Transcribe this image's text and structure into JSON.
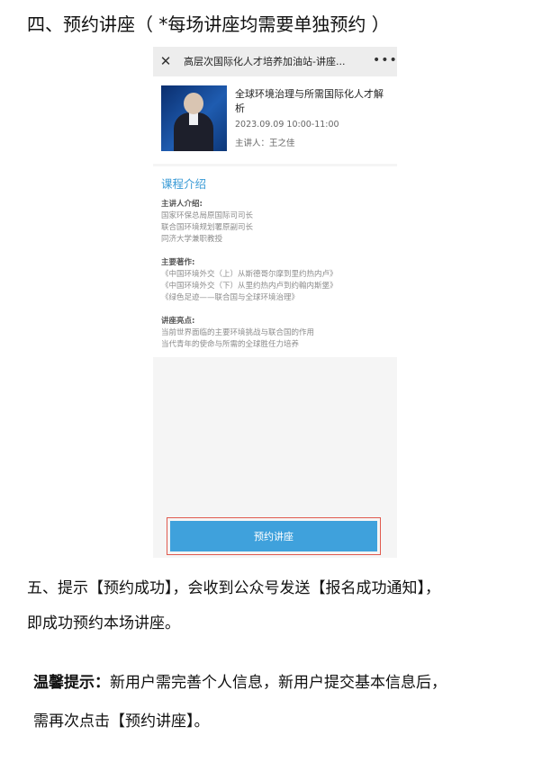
{
  "section4": {
    "title": "四、预约讲座（ *每场讲座均需要单独预约 ）"
  },
  "phone": {
    "topbar": {
      "close_icon": "close-icon",
      "title": "高层次国际化人才培养加油站-讲座...",
      "more_icon": "more-dots-icon"
    },
    "card": {
      "title": "全球环境治理与所需国际化人才解析",
      "time": "2023.09.09 10:00-11:00",
      "host": "主讲人：王之佳"
    },
    "intro": {
      "title": "课程介绍",
      "speaker_label": "主讲人介绍:",
      "speaker_lines": [
        "国家环保总局原国际司司长",
        "联合国环境规划署原副司长",
        "同济大学兼职教授"
      ],
      "works_label": "主要著作:",
      "works_lines": [
        "《中国环境外交（上）从斯德哥尔摩到里约热内卢》",
        "《中国环境外交（下）从里约热内卢到约翰内斯堡》",
        "《绿色足迹——联合国与全球环境治理》"
      ],
      "highlights_label": "讲座亮点:",
      "highlights_lines": [
        "当前世界面临的主要环境挑战与联合国的作用",
        "当代青年的使命与所需的全球胜任力培养"
      ]
    },
    "reserve_button": "预约讲座"
  },
  "section5": {
    "line1": "五、提示【预约成功】，会收到公众号发送【报名成功通知】，",
    "line2": "即成功预约本场讲座。"
  },
  "tip": {
    "label": "温馨提示",
    "colon": "：",
    "line1": "新用户需完善个人信息，新用户提交基本信息后，",
    "line2": "需再次点击【预约讲座】。"
  }
}
